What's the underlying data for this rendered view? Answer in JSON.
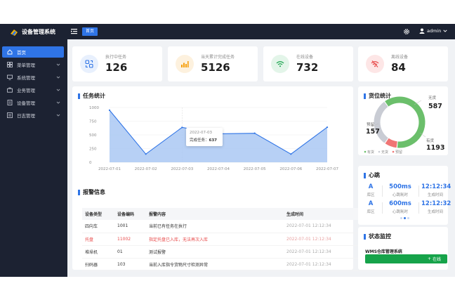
{
  "app": {
    "title": "设备管理系统"
  },
  "header": {
    "home_tab": "首页",
    "username": "admin"
  },
  "sidebar": {
    "items": [
      {
        "label": "首页",
        "icon": "home-icon",
        "active": true
      },
      {
        "label": "菜单管理",
        "icon": "grid-icon"
      },
      {
        "label": "系统管理",
        "icon": "monitor-icon"
      },
      {
        "label": "业务管理",
        "icon": "briefcase-icon"
      },
      {
        "label": "设备管理",
        "icon": "device-icon"
      },
      {
        "label": "日志管理",
        "icon": "log-icon"
      }
    ]
  },
  "stats": [
    {
      "label": "执行中任务",
      "value": "126",
      "icon": "task-icon",
      "color": "#2f74e6",
      "bg": "#e8f0fd"
    },
    {
      "label": "当天累计完成任务",
      "value": "5126",
      "icon": "bar-chart-icon",
      "color": "#f59e0b",
      "bg": "#fdf1de"
    },
    {
      "label": "在线设备",
      "value": "732",
      "icon": "wifi-icon",
      "color": "#16a34a",
      "bg": "#e3f5e9"
    },
    {
      "label": "离线设备",
      "value": "84",
      "icon": "wifi-off-icon",
      "color": "#e84a4a",
      "bg": "#fde6e6"
    }
  ],
  "task_chart": {
    "title": "任务统计",
    "tooltip": {
      "date": "2022-07-03",
      "label": "完成任务：",
      "value": "637"
    }
  },
  "alarms": {
    "title": "报警信息",
    "columns": [
      "设备类型",
      "设备编码",
      "报警内容",
      "生成时间"
    ],
    "rows": [
      {
        "type": "四向车",
        "code": "1001",
        "content": "当前已有任务在执行",
        "time": "2022-07-01 12:12:34",
        "warn": false
      },
      {
        "type": "托盘",
        "code": "11002",
        "content": "指定托盘已入库，无法再次入库",
        "time": "2022-07-01 12:12:34",
        "warn": true
      },
      {
        "type": "堆垛机",
        "code": "01",
        "content": "测试报警",
        "time": "2022-07-01 12:12:34",
        "warn": false
      },
      {
        "type": "扫码器",
        "code": "103",
        "content": "当前入库指令货物尺寸检测异常",
        "time": "2022-07-01 12:12:34",
        "warn": false
      }
    ]
  },
  "location_stats": {
    "title": "货位统计",
    "slices": [
      {
        "label": "有货",
        "value": 1193,
        "color": "#6bbf6b"
      },
      {
        "label": "无货",
        "value": 587,
        "color": "#c9ccd4"
      },
      {
        "label": "预留",
        "value": 157,
        "color": "#f07575"
      }
    ]
  },
  "heartbeat": {
    "title": "心跳",
    "rows": [
      {
        "area": "A",
        "area_label": "库区",
        "interval": "500ms",
        "interval_label": "心跳耗时",
        "time": "12:12:34",
        "time_label": "生成时间"
      },
      {
        "area": "A",
        "area_label": "库区",
        "interval": "600ms",
        "interval_label": "心跳耗时",
        "time": "12:12:32",
        "time_label": "生成时间"
      }
    ]
  },
  "status": {
    "title": "状态监控",
    "system": "WMS仓库管理系统",
    "state": "在线"
  },
  "chart_data": {
    "type": "area",
    "x": [
      "2022-07-01",
      "2022-07-02",
      "2022-07-03",
      "2022-07-04",
      "2022-07-05",
      "2022-07-06",
      "2022-07-07"
    ],
    "series": [
      {
        "values": [
          950,
          150,
          637,
          520,
          530,
          150,
          640
        ]
      }
    ],
    "yticks": [
      0,
      250,
      500,
      750,
      1000
    ],
    "ylim": [
      0,
      1000
    ],
    "color": "#2f74e6"
  }
}
